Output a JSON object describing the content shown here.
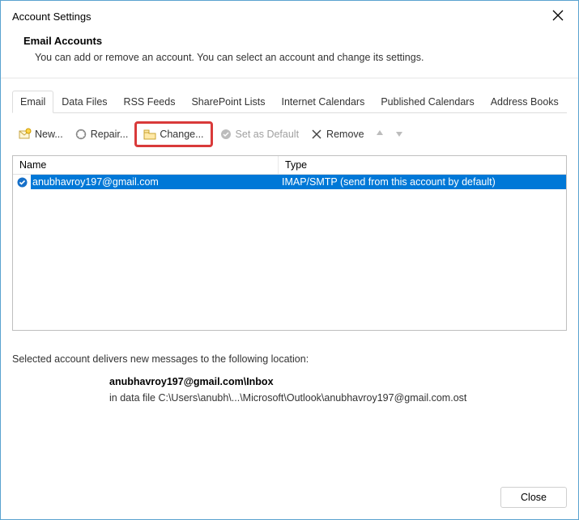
{
  "window": {
    "title": "Account Settings"
  },
  "header": {
    "heading": "Email Accounts",
    "description": "You can add or remove an account. You can select an account and change its settings."
  },
  "tabs": [
    {
      "label": "Email",
      "active": true
    },
    {
      "label": "Data Files",
      "active": false
    },
    {
      "label": "RSS Feeds",
      "active": false
    },
    {
      "label": "SharePoint Lists",
      "active": false
    },
    {
      "label": "Internet Calendars",
      "active": false
    },
    {
      "label": "Published Calendars",
      "active": false
    },
    {
      "label": "Address Books",
      "active": false
    }
  ],
  "toolbar": {
    "new": "New...",
    "repair": "Repair...",
    "change": "Change...",
    "set_default": "Set as Default",
    "remove": "Remove"
  },
  "list": {
    "columns": {
      "name": "Name",
      "type": "Type"
    },
    "rows": [
      {
        "name": "anubhavroy197@gmail.com",
        "type": "IMAP/SMTP (send from this account by default)",
        "is_default": true
      }
    ]
  },
  "delivery": {
    "label": "Selected account delivers new messages to the following location:",
    "location_bold": "anubhavroy197@gmail.com\\Inbox",
    "location_path": "in data file C:\\Users\\anubh\\...\\Microsoft\\Outlook\\anubhavroy197@gmail.com.ost"
  },
  "footer": {
    "close": "Close"
  }
}
